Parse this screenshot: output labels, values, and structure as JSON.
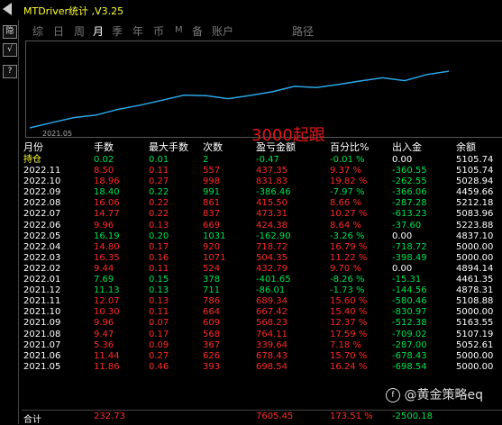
{
  "window": {
    "title": "MTDriver统计 ,V3.25"
  },
  "toolbar_side": [
    "隐",
    "√",
    "?"
  ],
  "tabs": [
    "综",
    "日",
    "周",
    "月",
    "季",
    "年",
    "币",
    "M",
    "备",
    "账户",
    "路径"
  ],
  "active_tab": "月",
  "chart": {
    "date_label": "2021.05",
    "watermark": "3000起跟",
    "line_color": "#2ba6e6",
    "chart_data": {
      "type": "line",
      "series": [
        {
          "values": [
            4461.35,
            4878.31,
            5108.88,
            5163.55,
            5107.19,
            5052.61,
            5000.0,
            5000.0,
            4894.14,
            5000.0,
            5000.0,
            4837.1,
            5223.88,
            5083.96,
            5212.18,
            5128.94,
            4459.66,
            5028.94,
            5105.74
          ]
        }
      ]
    }
  },
  "table": {
    "headers": [
      "月份",
      "手数",
      "最大手数",
      "次数",
      "盈亏金额",
      "百分比%",
      "出入金",
      "余额"
    ],
    "rows": [
      {
        "month": "持仓",
        "lots": "0.02",
        "max": "0.01",
        "count": "2",
        "pnl": "-0.47",
        "pct": "-0.01 %",
        "io": "0.00",
        "bal": "5105.74",
        "color": "green",
        "iocolor": "white"
      },
      {
        "month": "2022.11",
        "lots": "8.50",
        "max": "0.11",
        "count": "557",
        "pnl": "437.35",
        "pct": "9.37 %",
        "io": "-360.55",
        "bal": "5105.74",
        "color": "red",
        "iocolor": "green"
      },
      {
        "month": "2022.10",
        "lots": "18.96",
        "max": "0.27",
        "count": "998",
        "pnl": "831.83",
        "pct": "19.82 %",
        "io": "-262.55",
        "bal": "5028.94",
        "color": "red",
        "iocolor": "green"
      },
      {
        "month": "2022.09",
        "lots": "18.40",
        "max": "0.22",
        "count": "991",
        "pnl": "-386.46",
        "pct": "-7.97 %",
        "io": "-366.06",
        "bal": "4459.66",
        "color": "green",
        "iocolor": "green"
      },
      {
        "month": "2022.08",
        "lots": "16.06",
        "max": "0.22",
        "count": "861",
        "pnl": "415.50",
        "pct": "8.66 %",
        "io": "-287.28",
        "bal": "5212.18",
        "color": "red",
        "iocolor": "green"
      },
      {
        "month": "2022.07",
        "lots": "14.77",
        "max": "0.22",
        "count": "837",
        "pnl": "473.31",
        "pct": "10.27 %",
        "io": "-613.23",
        "bal": "5083.96",
        "color": "red",
        "iocolor": "green"
      },
      {
        "month": "2022.06",
        "lots": "9.96",
        "max": "0.13",
        "count": "669",
        "pnl": "424.38",
        "pct": "8.64 %",
        "io": "-37.60",
        "bal": "5223.88",
        "color": "red",
        "iocolor": "green"
      },
      {
        "month": "2022.05",
        "lots": "16.19",
        "max": "0.20",
        "count": "1031",
        "pnl": "-162.90",
        "pct": "-3.26 %",
        "io": "0.00",
        "bal": "4837.10",
        "color": "green",
        "iocolor": "white"
      },
      {
        "month": "2022.04",
        "lots": "14.80",
        "max": "0.17",
        "count": "920",
        "pnl": "718.72",
        "pct": "16.79 %",
        "io": "-718.72",
        "bal": "5000.00",
        "color": "red",
        "iocolor": "green"
      },
      {
        "month": "2022.03",
        "lots": "16.35",
        "max": "0.16",
        "count": "1071",
        "pnl": "504.35",
        "pct": "11.22 %",
        "io": "-398.49",
        "bal": "5000.00",
        "color": "red",
        "iocolor": "green"
      },
      {
        "month": "2022.02",
        "lots": "9.44",
        "max": "0.11",
        "count": "524",
        "pnl": "432.79",
        "pct": "9.70 %",
        "io": "0.00",
        "bal": "4894.14",
        "color": "red",
        "iocolor": "white"
      },
      {
        "month": "2022.01",
        "lots": "7.69",
        "max": "0.15",
        "count": "378",
        "pnl": "-401.65",
        "pct": "-8.26 %",
        "io": "-15.31",
        "bal": "4461.35",
        "color": "green",
        "iocolor": "green"
      },
      {
        "month": "2021.12",
        "lots": "11.13",
        "max": "0.13",
        "count": "711",
        "pnl": "-86.01",
        "pct": "-1.73 %",
        "io": "-144.56",
        "bal": "4878.31",
        "color": "green",
        "iocolor": "green"
      },
      {
        "month": "2021.11",
        "lots": "12.07",
        "max": "0.13",
        "count": "786",
        "pnl": "689.34",
        "pct": "15.60 %",
        "io": "-580.46",
        "bal": "5108.88",
        "color": "red",
        "iocolor": "green"
      },
      {
        "month": "2021.10",
        "lots": "10.30",
        "max": "0.11",
        "count": "664",
        "pnl": "667.42",
        "pct": "15.40 %",
        "io": "-830.97",
        "bal": "5000.00",
        "color": "red",
        "iocolor": "green"
      },
      {
        "month": "2021.09",
        "lots": "9.96",
        "max": "0.07",
        "count": "609",
        "pnl": "568.23",
        "pct": "12.37 %",
        "io": "-512.38",
        "bal": "5163.55",
        "color": "red",
        "iocolor": "green"
      },
      {
        "month": "2021.08",
        "lots": "9.47",
        "max": "0.17",
        "count": "568",
        "pnl": "764.11",
        "pct": "17.59 %",
        "io": "-709.02",
        "bal": "5107.19",
        "color": "red",
        "iocolor": "green"
      },
      {
        "month": "2021.07",
        "lots": "5.36",
        "max": "0.09",
        "count": "367",
        "pnl": "339.64",
        "pct": "7.18 %",
        "io": "-287.00",
        "bal": "5052.61",
        "color": "red",
        "iocolor": "green"
      },
      {
        "month": "2021.06",
        "lots": "11.44",
        "max": "0.27",
        "count": "626",
        "pnl": "678.43",
        "pct": "15.70 %",
        "io": "-678.43",
        "bal": "5000.00",
        "color": "red",
        "iocolor": "green"
      },
      {
        "month": "2021.05",
        "lots": "11.86",
        "max": "0.46",
        "count": "393",
        "pnl": "698.54",
        "pct": "16.24 %",
        "io": "-698.54",
        "bal": "5000.00",
        "color": "red",
        "iocolor": "green"
      }
    ],
    "total": {
      "label": "合计",
      "lots": "232.73",
      "pnl": "7605.45",
      "pct": "173.51 %",
      "io": "-2500.18"
    }
  },
  "brand": {
    "circle": "f",
    "text": "@黄金策略eq"
  }
}
